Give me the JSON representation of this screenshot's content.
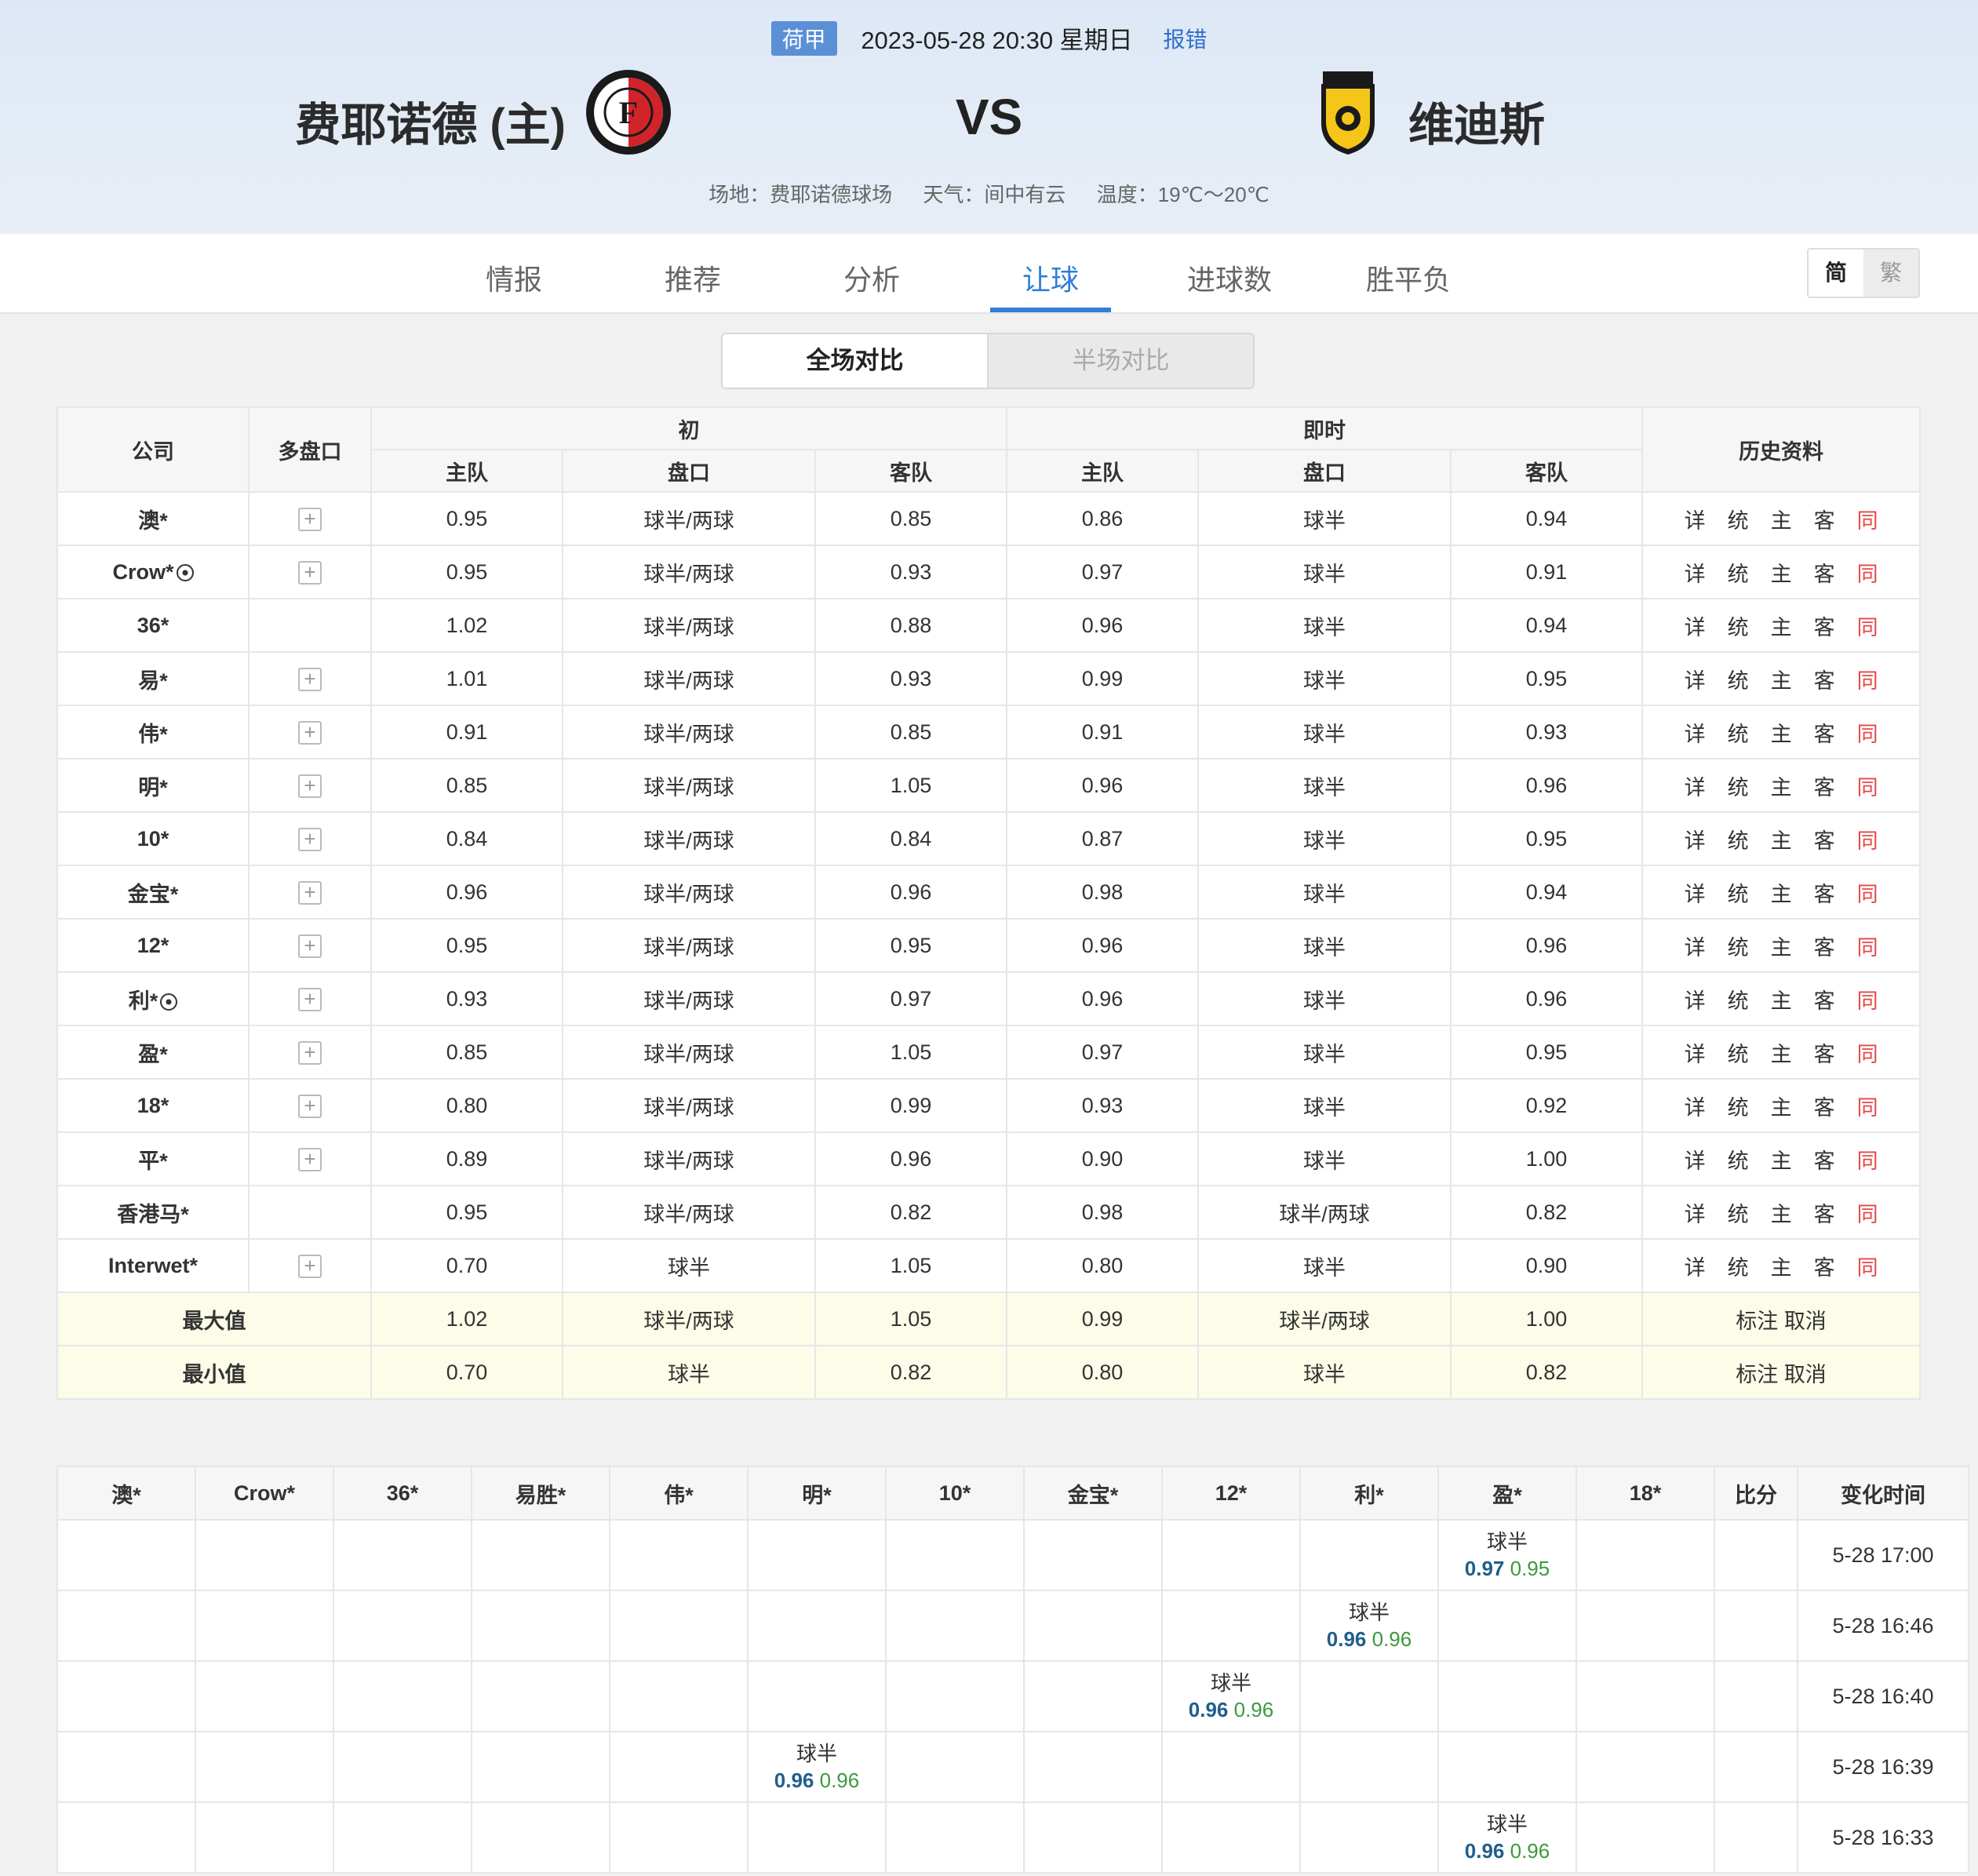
{
  "match": {
    "league": "荷甲",
    "datetime": "2023-05-28 20:30 星期日",
    "report": "报错",
    "home": "费耶诺德 (主)",
    "vs": "VS",
    "away": "维迪斯",
    "venue": "场地：费耶诺德球场",
    "weather": "天气：间中有云",
    "temperature": "温度：19℃～20℃"
  },
  "nav": {
    "tabs": [
      "情报",
      "推荐",
      "分析",
      "让球",
      "进球数",
      "胜平负"
    ],
    "active": "让球",
    "lang_simplified": "简",
    "lang_traditional": "繁"
  },
  "segment": {
    "full": "全场对比",
    "half": "半场对比"
  },
  "odds_table": {
    "headers": {
      "company": "公司",
      "multi": "多盘口",
      "initial": "初",
      "live": "即时",
      "history": "历史资料",
      "home": "主队",
      "line": "盘口",
      "away": "客队"
    },
    "history_links": [
      "详",
      "统",
      "主",
      "客",
      "同"
    ],
    "rows": [
      {
        "company": "澳*",
        "ball": false,
        "multi": true,
        "i_home": "0.95",
        "i_line": "球半/两球",
        "i_away": "0.85",
        "l_home": "0.86",
        "l_line": "球半",
        "l_away": "0.94"
      },
      {
        "company": "Crow*",
        "ball": true,
        "multi": true,
        "i_home": "0.95",
        "i_line": "球半/两球",
        "i_away": "0.93",
        "l_home": "0.97",
        "l_line": "球半",
        "l_away": "0.91"
      },
      {
        "company": "36*",
        "ball": false,
        "multi": false,
        "i_home": "1.02",
        "i_line": "球半/两球",
        "i_away": "0.88",
        "l_home": "0.96",
        "l_line": "球半",
        "l_away": "0.94"
      },
      {
        "company": "易*",
        "ball": false,
        "multi": true,
        "i_home": "1.01",
        "i_line": "球半/两球",
        "i_away": "0.93",
        "l_home": "0.99",
        "l_line": "球半",
        "l_away": "0.95"
      },
      {
        "company": "伟*",
        "ball": false,
        "multi": true,
        "i_home": "0.91",
        "i_line": "球半/两球",
        "i_away": "0.85",
        "l_home": "0.91",
        "l_line": "球半",
        "l_away": "0.93"
      },
      {
        "company": "明*",
        "ball": false,
        "multi": true,
        "i_home": "0.85",
        "i_line": "球半/两球",
        "i_away": "1.05",
        "l_home": "0.96",
        "l_line": "球半",
        "l_away": "0.96"
      },
      {
        "company": "10*",
        "ball": false,
        "multi": true,
        "i_home": "0.84",
        "i_line": "球半/两球",
        "i_away": "0.84",
        "l_home": "0.87",
        "l_line": "球半",
        "l_away": "0.95"
      },
      {
        "company": "金宝*",
        "ball": false,
        "multi": true,
        "i_home": "0.96",
        "i_line": "球半/两球",
        "i_away": "0.96",
        "l_home": "0.98",
        "l_line": "球半",
        "l_away": "0.94"
      },
      {
        "company": "12*",
        "ball": false,
        "multi": true,
        "i_home": "0.95",
        "i_line": "球半/两球",
        "i_away": "0.95",
        "l_home": "0.96",
        "l_line": "球半",
        "l_away": "0.96"
      },
      {
        "company": "利*",
        "ball": true,
        "multi": true,
        "i_home": "0.93",
        "i_line": "球半/两球",
        "i_away": "0.97",
        "l_home": "0.96",
        "l_line": "球半",
        "l_away": "0.96"
      },
      {
        "company": "盈*",
        "ball": false,
        "multi": true,
        "i_home": "0.85",
        "i_line": "球半/两球",
        "i_away": "1.05",
        "l_home": "0.97",
        "l_line": "球半",
        "l_away": "0.95"
      },
      {
        "company": "18*",
        "ball": false,
        "multi": true,
        "i_home": "0.80",
        "i_line": "球半/两球",
        "i_away": "0.99",
        "l_home": "0.93",
        "l_line": "球半",
        "l_away": "0.92"
      },
      {
        "company": "平*",
        "ball": false,
        "multi": true,
        "i_home": "0.89",
        "i_line": "球半/两球",
        "i_away": "0.96",
        "l_home": "0.90",
        "l_line": "球半",
        "l_away": "1.00"
      },
      {
        "company": "香港马*",
        "ball": false,
        "multi": false,
        "i_home": "0.95",
        "i_line": "球半/两球",
        "i_away": "0.82",
        "l_home": "0.98",
        "l_line": "球半/两球",
        "l_away": "0.82"
      },
      {
        "company": "Interwet*",
        "ball": false,
        "multi": true,
        "i_home": "0.70",
        "i_line": "球半",
        "i_away": "1.05",
        "l_home": "0.80",
        "l_line": "球半",
        "l_away": "0.90"
      }
    ],
    "summary": [
      {
        "label": "最大值",
        "i_home": "1.02",
        "i_line": "球半/两球",
        "i_away": "1.05",
        "l_home": "0.99",
        "l_line": "球半/两球",
        "l_away": "1.00",
        "mark": "标注",
        "cancel": "取消"
      },
      {
        "label": "最小值",
        "i_home": "0.70",
        "i_line": "球半",
        "i_away": "0.82",
        "l_home": "0.80",
        "l_line": "球半",
        "l_away": "0.82",
        "mark": "标注",
        "cancel": "取消"
      }
    ]
  },
  "changes_table": {
    "headers": [
      "澳*",
      "Crow*",
      "36*",
      "易胜*",
      "伟*",
      "明*",
      "10*",
      "金宝*",
      "12*",
      "利*",
      "盈*",
      "18*",
      "比分",
      "变化时间"
    ],
    "rows": [
      {
        "col": 10,
        "line": "球半",
        "home": "0.97",
        "away": "0.95",
        "time": "5-28 17:00"
      },
      {
        "col": 9,
        "line": "球半",
        "home": "0.96",
        "away": "0.96",
        "time": "5-28 16:46"
      },
      {
        "col": 8,
        "line": "球半",
        "home": "0.96",
        "away": "0.96",
        "time": "5-28 16:40"
      },
      {
        "col": 5,
        "line": "球半",
        "home": "0.96",
        "away": "0.96",
        "time": "5-28 16:39"
      },
      {
        "col": 10,
        "line": "球半",
        "home": "0.96",
        "away": "0.96",
        "time": "5-28 16:33"
      }
    ]
  },
  "colors": {
    "accent": "#2f7fd6",
    "league_badge": "#5b8fd6",
    "same_link": "#e54848",
    "summary_bg": "#fcfce8"
  }
}
